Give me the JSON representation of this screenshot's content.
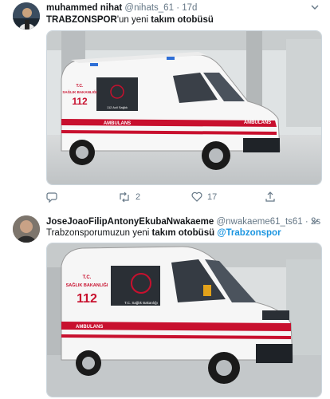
{
  "tweets": [
    {
      "display_name": "muhammed nihat",
      "handle": "@nihats_61",
      "time": "17d",
      "text_bold": "TRABZONSPOR",
      "text_plain": "'un yeni ",
      "text_bold2": "takım otobüsü",
      "vehicle": {
        "sign_line1": "T.C.",
        "sign_line2": "SAĞLIK BAKANLIĞI",
        "sign_number": "112",
        "side_text": "AMBULANS",
        "hood_text": "AMBULANS",
        "logo_text": "112 Acil Sağlık"
      },
      "actions": {
        "reply_count": "",
        "retweet_count": "2",
        "like_count": "17"
      }
    },
    {
      "display_name": "JoseJoaoFilipAntonyEkubaNwakaeme",
      "handle": "@nwakaeme61_ts61",
      "time": "2s",
      "text_plain": "Trabzonsporumuzun yeni ",
      "text_bold": "takım otobüsü",
      "text_mention": "@Trabzonspor",
      "vehicle": {
        "sign_line1": "T.C.",
        "sign_line2": "SAĞLIK BAKANLIĞI",
        "sign_number": "112",
        "side_text": "AMBULANS",
        "logo_text": "T.C. Sağlık Bakanlığı"
      }
    }
  ],
  "colors": {
    "text": "#14171a",
    "meta": "#657786",
    "link": "#1b95e0",
    "ambulance_red": "#c8102e"
  },
  "icons": [
    "chevron-down-icon",
    "reply-icon",
    "retweet-icon",
    "like-icon",
    "share-icon"
  ]
}
